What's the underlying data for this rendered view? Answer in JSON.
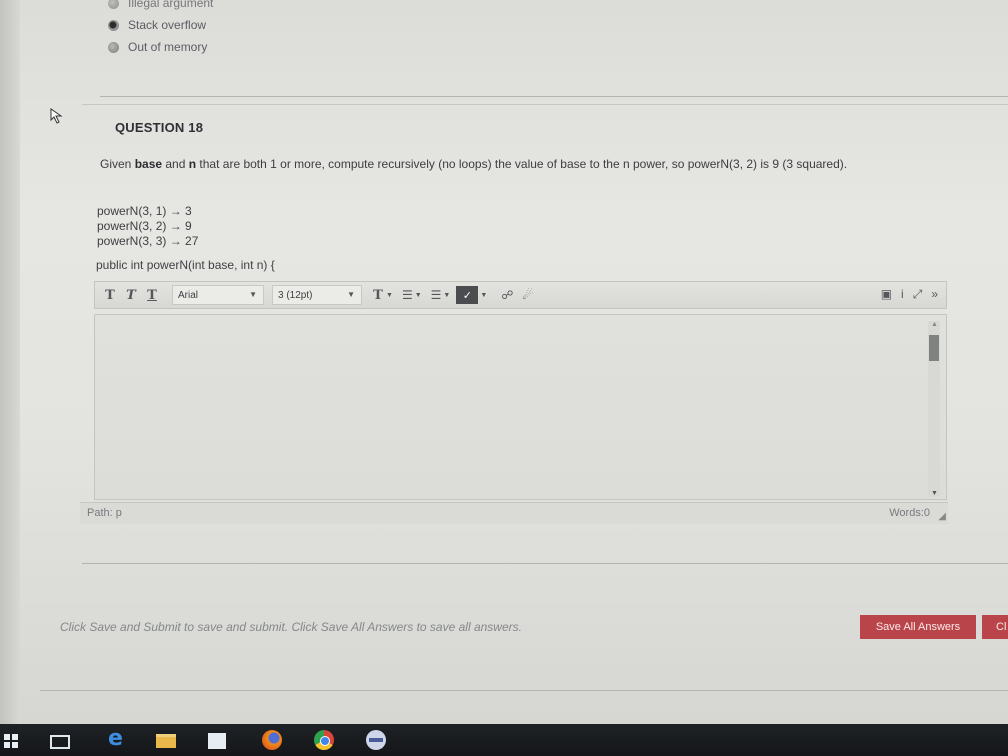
{
  "previous_question": {
    "options": [
      {
        "label": "Illegal argument",
        "selected": false
      },
      {
        "label": "Stack overflow",
        "selected": true
      },
      {
        "label": "Out of memory",
        "selected": false
      }
    ]
  },
  "question": {
    "title": "QUESTION 18",
    "prompt_part1": "Given ",
    "prompt_bold1": "base",
    "prompt_part2": " and ",
    "prompt_bold2": "n",
    "prompt_part3": " that are both 1 or more, compute recursively (no loops) the value of base to the n power, so powerN(3, 2) is 9 (3 squared).",
    "examples": [
      "powerN(3, 1) → 3",
      "powerN(3, 2) → 9",
      "powerN(3, 3) → 27"
    ],
    "signature": "public int powerN(int base, int n) {"
  },
  "editor": {
    "toolbar": {
      "bold": "T",
      "italic": "T",
      "underline": "T",
      "font_family": "Arial",
      "font_size": "3 (12pt)",
      "text_color": "T",
      "bullets": "☰",
      "numbering": "☰",
      "link": "☍",
      "unlink": "☄",
      "preview": "▣",
      "info": "i",
      "fullscreen": "⤢",
      "more": "»"
    },
    "path_label": "Path: p",
    "words_label": "Words:0"
  },
  "footer": {
    "instructions": "Click Save and Submit to save and submit. Click Save All Answers to save all answers.",
    "save_all_label": "Save All Answers",
    "cut_button_label": "Cl"
  },
  "colors": {
    "accent_button": "#b9444a",
    "taskbar": "#1f2226"
  },
  "taskbar": {
    "icons": [
      "windows-start-icon",
      "task-view-icon",
      "edge-browser-icon",
      "file-explorer-icon",
      "store-icon",
      "firefox-icon",
      "chrome-icon",
      "app-icon"
    ]
  }
}
